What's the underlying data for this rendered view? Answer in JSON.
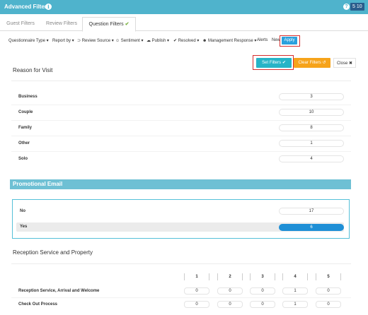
{
  "titlebar": {
    "title": "Advanced Filters",
    "counter": "5 10"
  },
  "tabs": [
    {
      "label": "Guest Filters"
    },
    {
      "label": "Review Filters"
    },
    {
      "label": "Question Filters",
      "check": "✔"
    }
  ],
  "filterbar": {
    "items": [
      "Questionnaire Type ▾",
      "Report by ▾",
      "Review Source ▾",
      "Sentiment ▾",
      "Publish ▾",
      "Resolved ▾",
      "Management Response ▾",
      "Alerts",
      "New"
    ],
    "apply": "Apply"
  },
  "actions": {
    "set_filters": "Set Filters ✔",
    "clear_filters": "Clear Filters ↺",
    "close": "Close ✖"
  },
  "reason": {
    "title": "Reason for Visit",
    "rows": [
      {
        "label": "Business",
        "count": "3"
      },
      {
        "label": "Couple",
        "count": "10"
      },
      {
        "label": "Family",
        "count": "8"
      },
      {
        "label": "Other",
        "count": "1"
      },
      {
        "label": "Solo",
        "count": "4"
      }
    ]
  },
  "promo": {
    "title": "Promotional Email",
    "rows": [
      {
        "label": "No",
        "count": "17"
      },
      {
        "label": "Yes",
        "count": "6"
      }
    ]
  },
  "reception": {
    "title": "Reception Service and Property",
    "columns": [
      "1",
      "2",
      "3",
      "4",
      "5"
    ],
    "rows": [
      {
        "label": "Reception Service, Arrival and Welcome",
        "values": [
          "0",
          "0",
          "0",
          "1",
          "0"
        ]
      },
      {
        "label": "Check Out Process",
        "values": [
          "0",
          "0",
          "0",
          "1",
          "0"
        ]
      }
    ]
  },
  "colors": {
    "header": "#4fb3cc",
    "apply": "#29a0dd",
    "set_filters": "#27b4c7",
    "clear_filters": "#f6a31a",
    "highlight_box": "#d62d2d",
    "selected": "#1e8fd6"
  }
}
